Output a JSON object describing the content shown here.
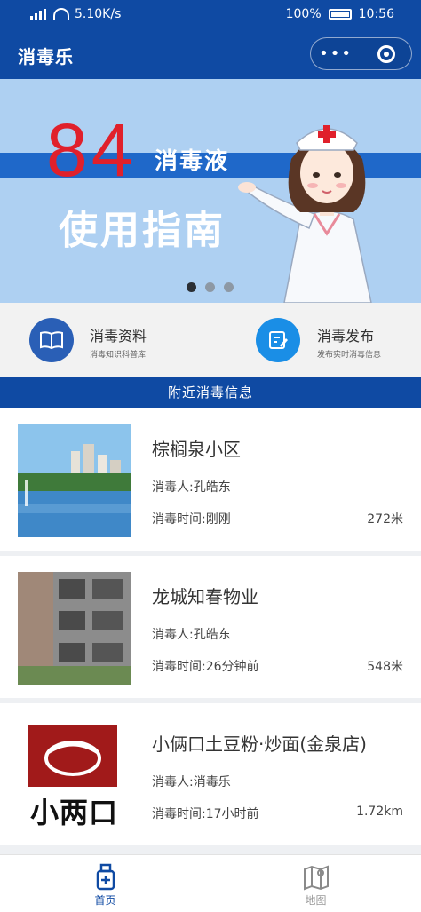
{
  "status_bar": {
    "network": "5.10K/s",
    "battery": "100%",
    "time": "10:56"
  },
  "header": {
    "title": "消毒乐",
    "more_icon": "ellipsis-icon",
    "close_icon": "target-icon"
  },
  "banner": {
    "number": "84",
    "subtitle": "消毒液",
    "headline": "使用指南",
    "slides": 3,
    "active_slide": 1
  },
  "actions": [
    {
      "title": "消毒资料",
      "desc": "消毒知识科普库",
      "icon": "book-icon",
      "color": "#2a5fb6"
    },
    {
      "title": "消毒发布",
      "desc": "发布实时消毒信息",
      "icon": "edit-icon",
      "color": "#1a8ee6"
    }
  ],
  "section": {
    "title": "附近消毒信息"
  },
  "list": [
    {
      "name": "棕榈泉小区",
      "person": "消毒人:孔皓东",
      "time": "消毒时间:刚刚",
      "distance": "272米"
    },
    {
      "name": "龙城知春物业",
      "person": "消毒人:孔皓东",
      "time": "消毒时间:26分钟前",
      "distance": "548米"
    },
    {
      "name": "小俩口土豆粉·炒面(金泉店)",
      "person": "消毒人:消毒乐",
      "time": "消毒时间:17小时前",
      "distance": "1.72km",
      "logo_text": "小两口"
    }
  ],
  "tabs": [
    {
      "label": "首页",
      "icon": "home-bottle-icon",
      "active": true
    },
    {
      "label": "地图",
      "icon": "map-icon",
      "active": false
    }
  ],
  "colors": {
    "primary": "#0f4aa3",
    "accent_red": "#e0202b"
  }
}
